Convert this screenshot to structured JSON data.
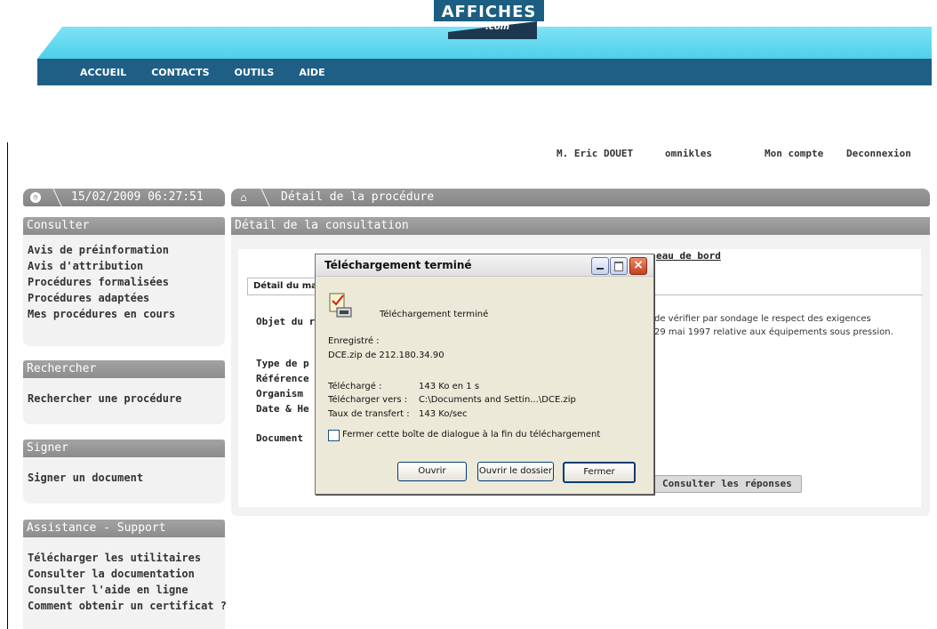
{
  "site": {
    "logo_text": "AFFICHES",
    "logo_suffix": ".com"
  },
  "nav": [
    "ACCUEIL",
    "CONTACTS",
    "OUTILS",
    "AIDE"
  ],
  "user": {
    "name": "M. Eric DOUET",
    "org": "omnikles",
    "account": "Mon compte",
    "logout": "Deconnexion"
  },
  "datetime": "15/02/2009 06:27:51",
  "breadcrumb": "Détail de la procédure",
  "sidebar": {
    "consulter": {
      "title": "Consulter",
      "items": [
        "Avis de préinformation",
        "Avis d'attribution",
        "Procédures formalisées",
        "Procédures adaptées",
        "Mes procédures en cours"
      ]
    },
    "rechercher": {
      "title": "Rechercher",
      "items": [
        "Rechercher une procédure"
      ]
    },
    "signer": {
      "title": "Signer",
      "items": [
        "Signer un document"
      ]
    },
    "assistance": {
      "title": "Assistance - Support",
      "items": [
        "Télécharger les utilitaires",
        "Consulter la documentation",
        "Consulter l'aide en ligne",
        "Comment obtenir un certificat ?"
      ]
    }
  },
  "main": {
    "title": "Détail de la consultation",
    "dashboard_link": "eau de bord",
    "tab": "Détail du ma",
    "labels": {
      "objet": "Objet du r",
      "type": "Type de p",
      "reference": "Référence",
      "organisme": "Organism",
      "date": "Date & He",
      "document": "Document"
    },
    "description_line1": "de vérifier par sondage le respect des exigences",
    "description_line2": "29 mai 1997 relative aux équipements sous pression.",
    "responses_button": "Consulter les réponses"
  },
  "dialog": {
    "title": "Téléchargement terminé",
    "heading": "Téléchargement terminé",
    "saved_label": "Enregistré :",
    "saved_value": "DCE.zip de 212.180.34.90",
    "downloaded_label": "Téléchargé :",
    "downloaded_value": "143 Ko en 1 s",
    "download_to_label": "Télécharger vers :",
    "download_to_value": "C:\\Documents and Settin...\\DCE.zip",
    "rate_label": "Taux de transfert :",
    "rate_value": "143 Ko/sec",
    "close_on_finish": "Fermer cette boîte de dialogue à la fin du téléchargement",
    "open": "Ouvrir",
    "open_folder": "Ouvrir le dossier",
    "close": "Fermer"
  }
}
